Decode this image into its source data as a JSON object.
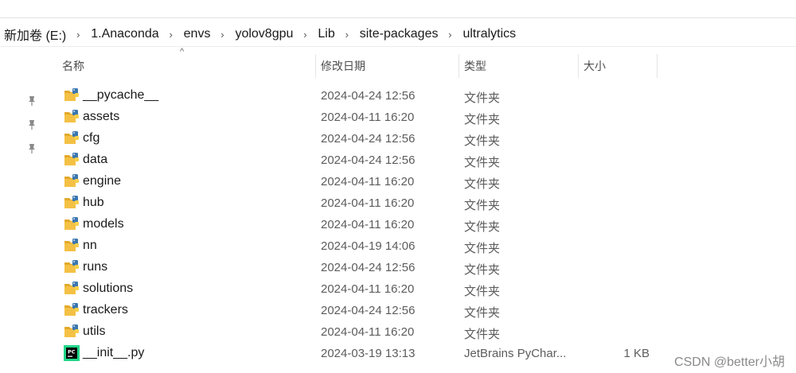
{
  "breadcrumb": [
    "新加卷 (E:)",
    "1.Anaconda",
    "envs",
    "yolov8gpu",
    "Lib",
    "site-packages",
    "ultralytics"
  ],
  "columns": {
    "name": "名称",
    "date": "修改日期",
    "type": "类型",
    "size": "大小"
  },
  "files": [
    {
      "name": "__pycache__",
      "date": "2024-04-24 12:56",
      "type": "文件夹",
      "size": "",
      "icon": "python-folder-icon"
    },
    {
      "name": "assets",
      "date": "2024-04-11 16:20",
      "type": "文件夹",
      "size": "",
      "icon": "python-folder-icon"
    },
    {
      "name": "cfg",
      "date": "2024-04-24 12:56",
      "type": "文件夹",
      "size": "",
      "icon": "python-folder-icon"
    },
    {
      "name": "data",
      "date": "2024-04-24 12:56",
      "type": "文件夹",
      "size": "",
      "icon": "python-folder-icon"
    },
    {
      "name": "engine",
      "date": "2024-04-11 16:20",
      "type": "文件夹",
      "size": "",
      "icon": "python-folder-icon"
    },
    {
      "name": "hub",
      "date": "2024-04-11 16:20",
      "type": "文件夹",
      "size": "",
      "icon": "python-folder-icon"
    },
    {
      "name": "models",
      "date": "2024-04-11 16:20",
      "type": "文件夹",
      "size": "",
      "icon": "python-folder-icon"
    },
    {
      "name": "nn",
      "date": "2024-04-19 14:06",
      "type": "文件夹",
      "size": "",
      "icon": "python-folder-icon"
    },
    {
      "name": "runs",
      "date": "2024-04-24 12:56",
      "type": "文件夹",
      "size": "",
      "icon": "python-folder-icon"
    },
    {
      "name": "solutions",
      "date": "2024-04-11 16:20",
      "type": "文件夹",
      "size": "",
      "icon": "python-folder-icon"
    },
    {
      "name": "trackers",
      "date": "2024-04-24 12:56",
      "type": "文件夹",
      "size": "",
      "icon": "python-folder-icon"
    },
    {
      "name": "utils",
      "date": "2024-04-11 16:20",
      "type": "文件夹",
      "size": "",
      "icon": "python-folder-icon"
    },
    {
      "name": "__init__.py",
      "date": "2024-03-19 13:13",
      "type": "JetBrains PyChar...",
      "size": "1 KB",
      "icon": "pycharm-file-icon"
    }
  ],
  "quick_access_pins": [
    "pin-icon",
    "pin-icon",
    "pin-icon"
  ],
  "watermark": "CSDN @better小胡",
  "colors": {
    "folder": "#f4c145",
    "folder_dark": "#e2a92a",
    "python_blue": "#3b77b0",
    "pycharm_green": "#21d789"
  }
}
